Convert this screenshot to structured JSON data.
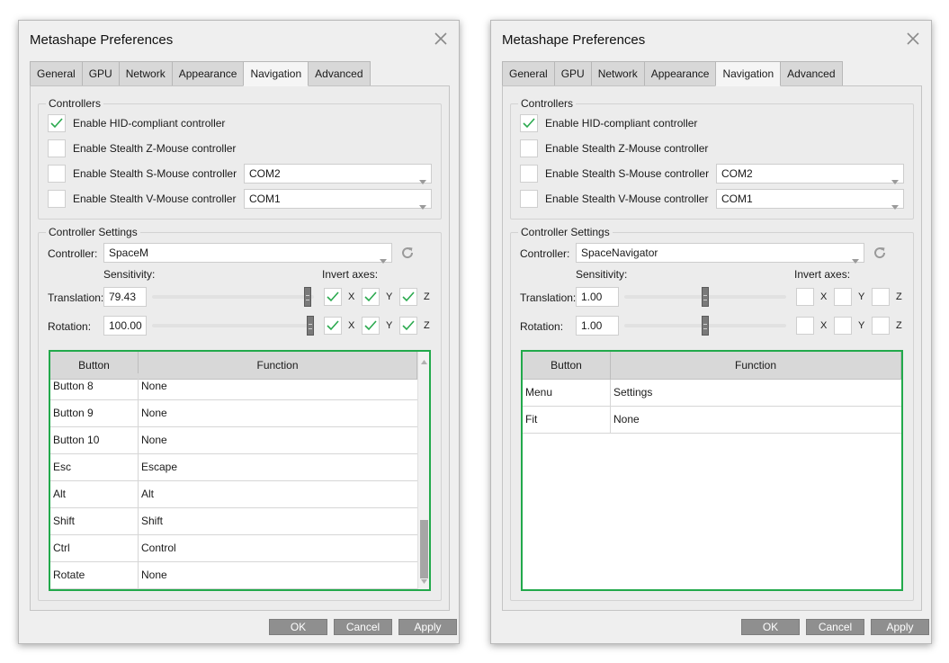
{
  "colors": {
    "accent_green": "#22a94b",
    "check_green": "#2aa94e",
    "button_gray": "#8f8f8f"
  },
  "icons": {
    "close": "close-icon",
    "refresh": "refresh-icon",
    "check": "checkmark-icon",
    "dropdown": "chevron-down-icon"
  },
  "dialogs": [
    {
      "title": "Metashape Preferences",
      "tabs": [
        "General",
        "GPU",
        "Network",
        "Appearance",
        "Navigation",
        "Advanced"
      ],
      "active_tab": "Navigation",
      "controllers": {
        "title": "Controllers",
        "hid_label": "Enable HID-compliant controller",
        "hid_checked": true,
        "zmouse_label": "Enable Stealth Z-Mouse controller",
        "zmouse_checked": false,
        "smouse_label": "Enable Stealth S-Mouse controller",
        "smouse_checked": false,
        "smouse_port": "COM2",
        "vmouse_label": "Enable Stealth V-Mouse controller",
        "vmouse_checked": false,
        "vmouse_port": "COM1"
      },
      "settings": {
        "title": "Controller Settings",
        "controller_label": "Controller:",
        "controller_value": "SpaceM",
        "sensitivity_label": "Sensitivity:",
        "invert_label": "Invert axes:",
        "translation_label": "Translation:",
        "translation_value": "79.43",
        "translation_level": 0.98,
        "translation_axes": {
          "x": true,
          "y": true,
          "z": true
        },
        "rotation_label": "Rotation:",
        "rotation_value": "100.00",
        "rotation_level": 1.0,
        "rotation_axes": {
          "x": true,
          "y": true,
          "z": true
        },
        "axis_x": "X",
        "axis_y": "Y",
        "axis_z": "Z"
      },
      "table": {
        "headers": [
          "Button",
          "Function"
        ],
        "rows": [
          [
            "Button 8",
            "None"
          ],
          [
            "Button 9",
            "None"
          ],
          [
            "Button 10",
            "None"
          ],
          [
            "Esc",
            "Escape"
          ],
          [
            "Alt",
            "Alt"
          ],
          [
            "Shift",
            "Shift"
          ],
          [
            "Ctrl",
            "Control"
          ],
          [
            "Rotate",
            "None"
          ]
        ],
        "scroll_position": 1.0
      },
      "buttons": {
        "ok": "OK",
        "cancel": "Cancel",
        "apply": "Apply"
      }
    },
    {
      "title": "Metashape Preferences",
      "tabs": [
        "General",
        "GPU",
        "Network",
        "Appearance",
        "Navigation",
        "Advanced"
      ],
      "active_tab": "Navigation",
      "controllers": {
        "title": "Controllers",
        "hid_label": "Enable HID-compliant controller",
        "hid_checked": true,
        "zmouse_label": "Enable Stealth Z-Mouse controller",
        "zmouse_checked": false,
        "smouse_label": "Enable Stealth S-Mouse controller",
        "smouse_checked": false,
        "smouse_port": "COM2",
        "vmouse_label": "Enable Stealth V-Mouse controller",
        "vmouse_checked": false,
        "vmouse_port": "COM1"
      },
      "settings": {
        "title": "Controller Settings",
        "controller_label": "Controller:",
        "controller_value": "SpaceNavigator",
        "sensitivity_label": "Sensitivity:",
        "invert_label": "Invert axes:",
        "translation_label": "Translation:",
        "translation_value": "1.00",
        "translation_level": 0.5,
        "translation_axes": {
          "x": false,
          "y": false,
          "z": false
        },
        "rotation_label": "Rotation:",
        "rotation_value": "1.00",
        "rotation_level": 0.5,
        "rotation_axes": {
          "x": false,
          "y": false,
          "z": false
        },
        "axis_x": "X",
        "axis_y": "Y",
        "axis_z": "Z"
      },
      "table": {
        "headers": [
          "Button",
          "Function"
        ],
        "rows": [
          [
            "Menu",
            "Settings"
          ],
          [
            "Fit",
            "None"
          ]
        ],
        "scroll_position": null
      },
      "buttons": {
        "ok": "OK",
        "cancel": "Cancel",
        "apply": "Apply"
      }
    }
  ]
}
